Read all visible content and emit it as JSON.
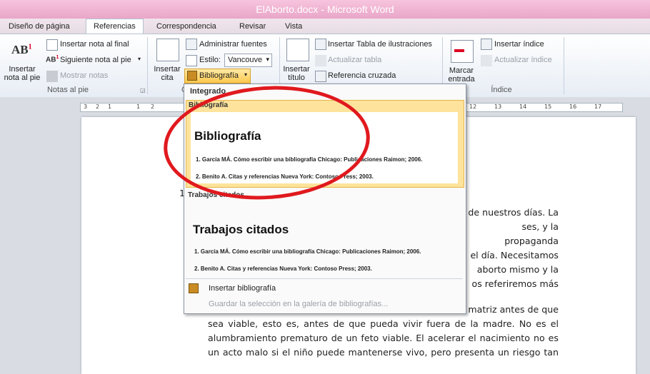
{
  "window": {
    "title": "ElAborto.docx - Microsoft Word"
  },
  "tabs": [
    "Diseño de página",
    "Referencias",
    "Correspondencia",
    "Revisar",
    "Vista"
  ],
  "ribbon": {
    "footnotes": {
      "insert_footnote": "Insertar\nnota al pie",
      "insert_endnote": "Insertar nota al final",
      "next_footnote": "Siguiente nota al pie",
      "show_notes": "Mostrar notas",
      "group_label": "Notas al pie"
    },
    "citations": {
      "insert_citation": "Insertar\ncita",
      "manage_sources": "Administrar fuentes",
      "style_label": "Estilo:",
      "style_value": "Vancouve",
      "bibliography": "Bibliografía",
      "group_label_partial": "C"
    },
    "captions": {
      "insert_caption": "Insertar\ntítulo",
      "insert_table_figures": "Insertar Tabla de ilustraciones",
      "update_table": "Actualizar tabla",
      "cross_reference": "Referencia cruzada"
    },
    "index": {
      "mark_entry": "Marcar\nentrada",
      "insert_index": "Insertar índice",
      "update_index": "Actualizar índice",
      "group_label": "Índice"
    }
  },
  "ruler": {
    "left_numbers": [
      "3",
      "2",
      "1",
      "1",
      "2"
    ],
    "right_numbers": [
      "12",
      "13",
      "14",
      "15",
      "16",
      "17"
    ]
  },
  "bibliography_menu": {
    "section_builtin": "Integrado",
    "item1": {
      "header": "Bibliografía",
      "title": "Bibliografía",
      "entries": [
        "1. García MÁ. Cómo escribir una bibliografía Chicago: Publicaciones Raimon; 2006.",
        "2. Benito A. Citas y referencias Nueva York: Contoso Press; 2003."
      ]
    },
    "item2": {
      "header": "Trabajos citados",
      "title": "Trabajos citados",
      "entries": [
        "1. García MÁ. Cómo escribir una bibliografía Chicago: Publicaciones Raimon; 2006.",
        "2. Benito A. Citas y referencias Nueva York: Contoso Press; 2003."
      ]
    },
    "insert_bibliography": "Insertar bibliografía",
    "save_selection": "Guardar la selección en la galería de bibliografías..."
  },
  "document": {
    "partial_number": "1",
    "lines_right": [
      "de nuestros días. La",
      "ses, y la propaganda",
      "el día. Necesitamos",
      "aborto mismo y la",
      "os referiremos más"
    ],
    "line_after": "matriz antes de que",
    "paragraph_lines": [
      "sea viable, esto es, antes de que pueda vivir fuera de la madre. No es el",
      "alumbramiento prematuro de un feto viable. El acelerar el nacimiento no es",
      "un acto malo si el niño puede mantenerse vivo, pero presenta un riesgo tan"
    ]
  }
}
